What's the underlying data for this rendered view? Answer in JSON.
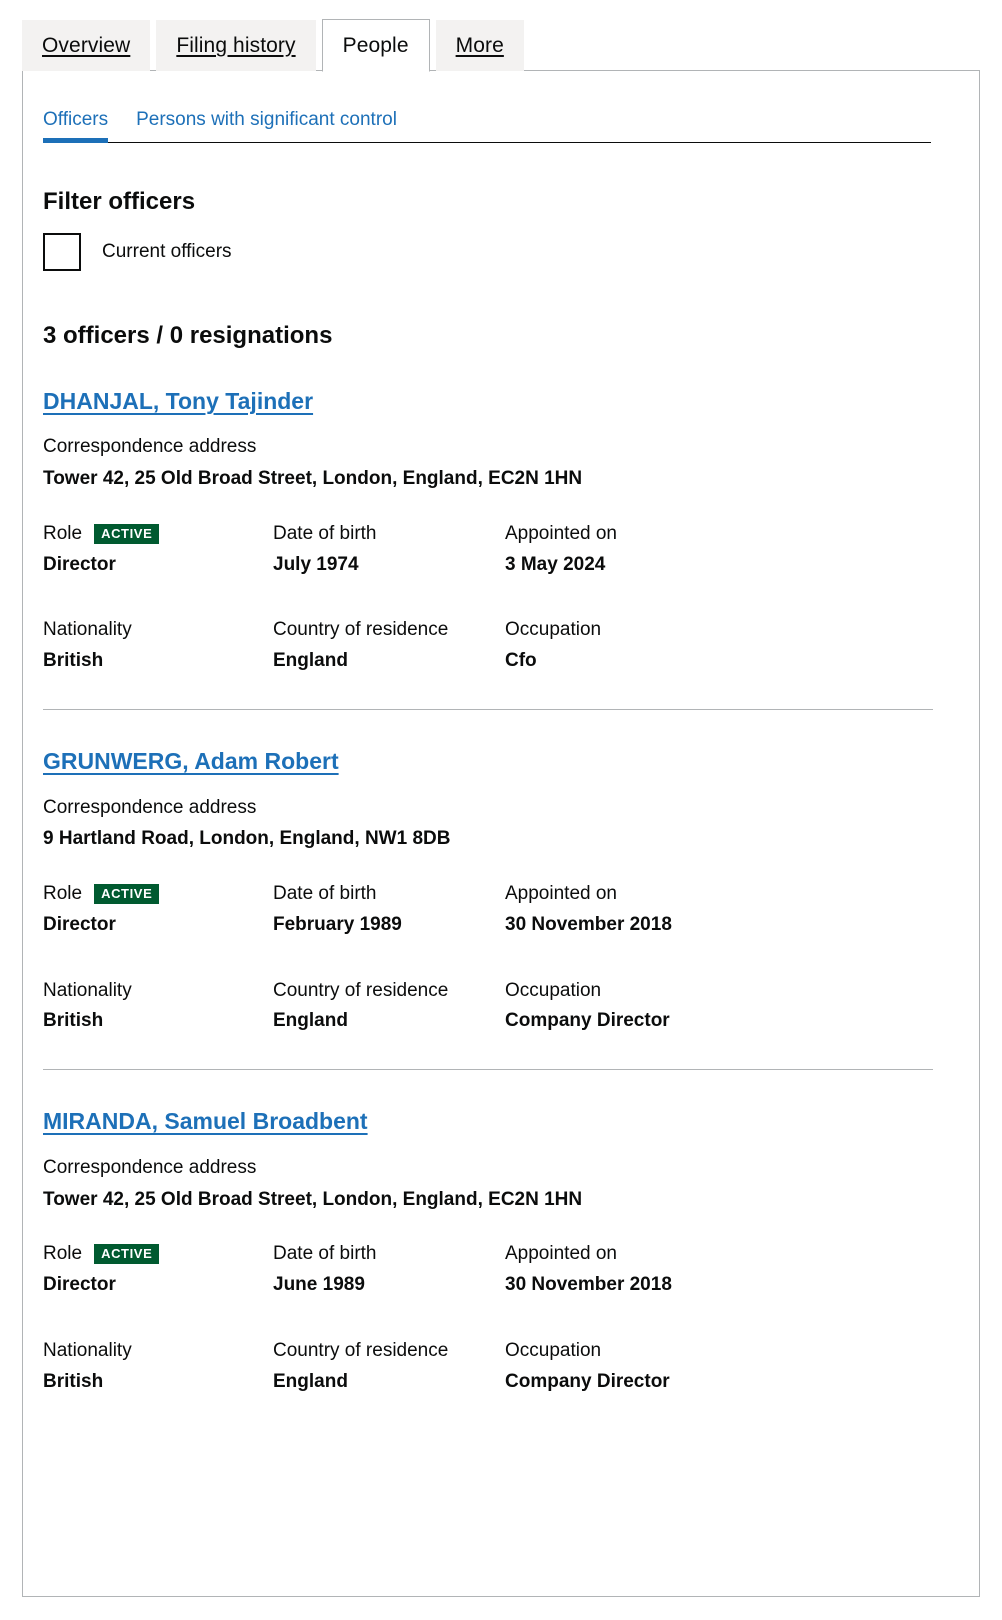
{
  "tabs": [
    {
      "label": "Overview",
      "active": false
    },
    {
      "label": "Filing history",
      "active": false
    },
    {
      "label": "People",
      "active": true
    },
    {
      "label": "More",
      "active": false
    }
  ],
  "subtabs": [
    {
      "label": "Officers",
      "selected": true
    },
    {
      "label": "Persons with significant control",
      "selected": false
    }
  ],
  "filter": {
    "heading": "Filter officers",
    "checkbox_label": "Current officers",
    "checked": false
  },
  "summary": "3 officers / 0 resignations",
  "labels": {
    "correspondence_address": "Correspondence address",
    "role": "Role",
    "date_of_birth": "Date of birth",
    "appointed_on": "Appointed on",
    "nationality": "Nationality",
    "country_of_residence": "Country of residence",
    "occupation": "Occupation"
  },
  "colors": {
    "link": "#1d70b8",
    "badge_active": "#005a30",
    "text": "#0b0c0c",
    "border": "#b1b4b6",
    "tab_inactive_bg": "#f3f2f1"
  },
  "officers": [
    {
      "name": "DHANJAL, Tony Tajinder",
      "address": "Tower 42, 25 Old Broad Street, London, England, EC2N 1HN",
      "status_badge": "ACTIVE",
      "role": "Director",
      "date_of_birth": "July 1974",
      "appointed_on": "3 May 2024",
      "nationality": "British",
      "country_of_residence": "England",
      "occupation": "Cfo"
    },
    {
      "name": "GRUNWERG, Adam Robert",
      "address": "9 Hartland Road, London, England, NW1 8DB",
      "status_badge": "ACTIVE",
      "role": "Director",
      "date_of_birth": "February 1989",
      "appointed_on": "30 November 2018",
      "nationality": "British",
      "country_of_residence": "England",
      "occupation": "Company Director"
    },
    {
      "name": "MIRANDA, Samuel Broadbent",
      "address": "Tower 42, 25 Old Broad Street, London, England, EC2N 1HN",
      "status_badge": "ACTIVE",
      "role": "Director",
      "date_of_birth": "June 1989",
      "appointed_on": "30 November 2018",
      "nationality": "British",
      "country_of_residence": "England",
      "occupation": "Company Director"
    }
  ]
}
